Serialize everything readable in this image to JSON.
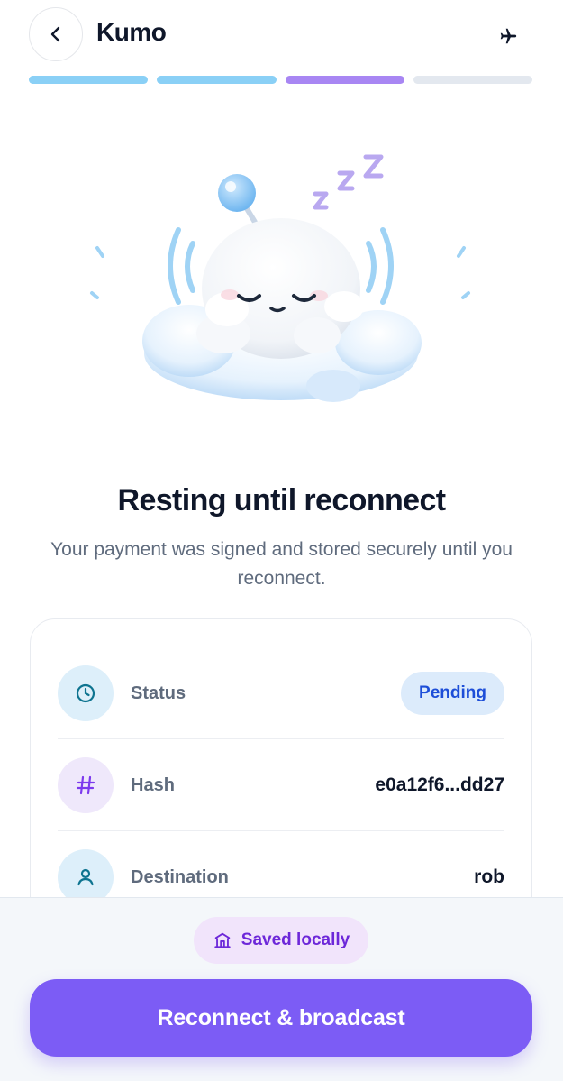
{
  "header": {
    "title": "Kumo",
    "back_icon": "chevron-left-icon",
    "action_icon": "airplane-icon"
  },
  "progress": {
    "steps_total": 4,
    "steps": [
      {
        "state": "done",
        "color": "#8ad0f6"
      },
      {
        "state": "done",
        "color": "#8ad0f6"
      },
      {
        "state": "current",
        "color": "#a886f3"
      },
      {
        "state": "upcoming",
        "color": "#e3e8ef"
      }
    ]
  },
  "illustration": {
    "subject": "sleeping-cloud-mascot",
    "sleep_text": "Z Z Z"
  },
  "headline": "Resting until reconnect",
  "subtitle": "Your payment was signed and stored securely until you reconnect.",
  "details": {
    "rows": [
      {
        "label": "Status",
        "value": "Pending",
        "icon": "clock-icon",
        "icon_color": "#0e7490",
        "icon_bg": "#ddeffa"
      },
      {
        "label": "Hash",
        "value": "e0a12f6...dd27",
        "icon": "hash-icon",
        "icon_color": "#7c3aed",
        "icon_bg": "#efe8fb"
      },
      {
        "label": "Destination",
        "value": "rob",
        "icon": "user-icon",
        "icon_color": "#0e7490",
        "icon_bg": "#ddeffa"
      }
    ]
  },
  "footer": {
    "saved_label": "Saved locally",
    "saved_icon": "bank-icon",
    "cta_label": "Reconnect & broadcast"
  },
  "colors": {
    "accent": "#7c5cf5",
    "badge_bg": "#dcebfb",
    "badge_text": "#1d4ed8"
  }
}
